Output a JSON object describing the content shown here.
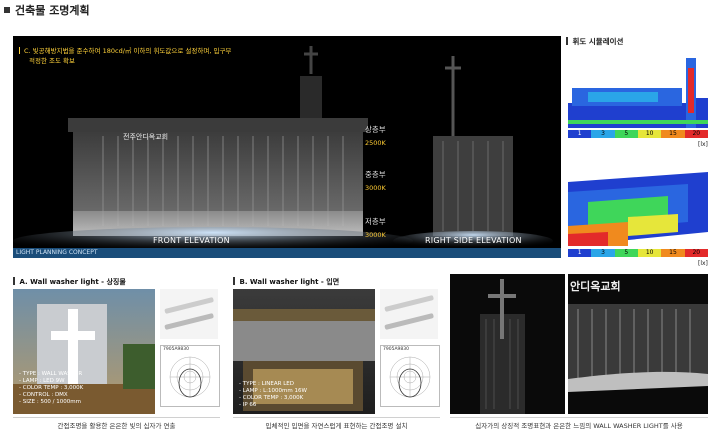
{
  "header": {
    "title": "건축물 조명계획"
  },
  "main": {
    "note_line1": "C. 빛공해방지법을 준수하여 180cd/㎡ 이하의 휘도값으로 설정하며, 입구부",
    "note_line2": "적정한 조도 확보",
    "sign": "전주안디옥교회",
    "floors": [
      {
        "label": "상층부",
        "temp": "2500K"
      },
      {
        "label": "중층부",
        "temp": "3000K"
      },
      {
        "label": "저층부",
        "temp": "3000K"
      }
    ],
    "front_caption": "FRONT ELEVATION",
    "side_caption": "RIGHT SIDE ELEVATION",
    "concept_label": "LIGHT PLANNING CONCEPT"
  },
  "simulation": {
    "title": "휘도 시뮬레이션",
    "scale": [
      "1",
      "3",
      "5",
      "10",
      "15",
      "20"
    ],
    "scale_colors": [
      "#1f3fcf",
      "#2aa5e8",
      "#3fd65a",
      "#e6e63a",
      "#f08a1e",
      "#e32a2a"
    ],
    "unit": "[lx]"
  },
  "section_a": {
    "title": "A. Wall washer light - 상징물",
    "specs": [
      "- TYPE : WALL WASHER",
      "- LAMP : LED 9W",
      "- COLOR TEMP : 3,000K",
      "- CONTROL : DMX",
      "- SIZE : 500 / 1000mm"
    ],
    "caption": "간접조명을 활용한 은은한 빛의 십자가 연출",
    "fixture_code": "7905A9830"
  },
  "section_b": {
    "title": "B. Wall washer light - 입면",
    "specs": [
      "- TYPE : LINEAR LED",
      "- LAMP : L:1000mm 16W",
      "- COLOR TEMP : 3,000K",
      "- IP 66"
    ],
    "caption": "입체적인 입면을 자연스럽게 표현하는 간접조명 설치",
    "fixture_code": "7905A9830"
  },
  "section_c": {
    "caption": "십자가의 상징적 조명표현과 은은한 느낌의 WALL WASHER LIGHT를 사용",
    "sign": "안디옥교회"
  }
}
